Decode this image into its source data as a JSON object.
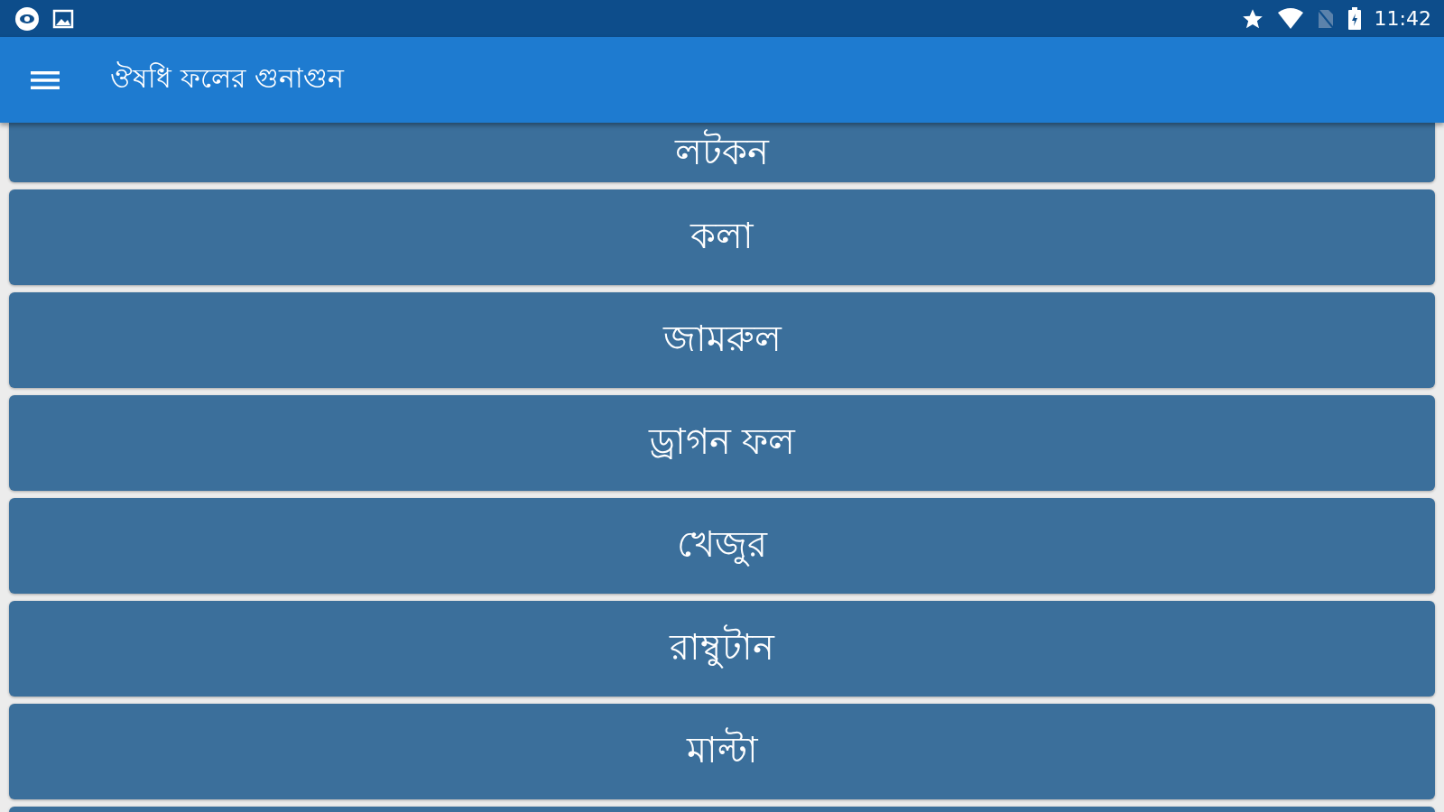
{
  "status_bar": {
    "time": "11:42"
  },
  "app_bar": {
    "title": "ঔষধি ফলের গুনাগুন"
  },
  "items": [
    {
      "label": "লটকন",
      "partial": true
    },
    {
      "label": "কলা",
      "partial": false
    },
    {
      "label": "জামরুল",
      "partial": false
    },
    {
      "label": "ড্রাগন ফল",
      "partial": false
    },
    {
      "label": "খেজুর",
      "partial": false
    },
    {
      "label": "রাম্বুটান",
      "partial": false
    },
    {
      "label": "মাল্টা",
      "partial": false
    }
  ]
}
